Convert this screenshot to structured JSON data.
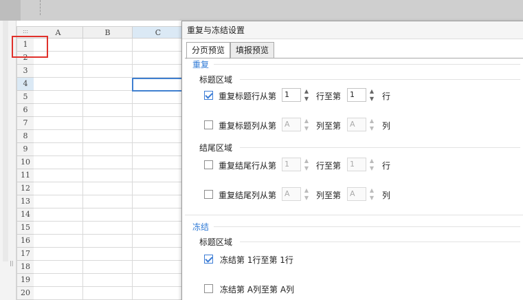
{
  "sheet": {
    "columns": [
      "A",
      "B",
      "C"
    ],
    "rows": [
      "1 (H)",
      "2",
      "3",
      "4",
      "5",
      "6",
      "7",
      "8",
      "9",
      "10",
      "11",
      "12",
      "13",
      "14",
      "15",
      "16",
      "17",
      "18",
      "19",
      "20"
    ],
    "selected_column": "C",
    "selected_row": "4"
  },
  "dialog": {
    "title": "重复与冻结设置",
    "tabs": [
      {
        "label": "分页预览",
        "active": true
      },
      {
        "label": "填报预览",
        "active": false
      }
    ],
    "repeat": {
      "section_label": "重复",
      "title_area_label": "标题区域",
      "row": {
        "checked": true,
        "label": "重复标题行从第",
        "from": "1",
        "mid": "行至第",
        "to": "1",
        "end": "行"
      },
      "col": {
        "checked": false,
        "label": "重复标题列从第",
        "from": "A",
        "mid": "列至第",
        "to": "A",
        "end": "列"
      },
      "footer_area_label": "结尾区域",
      "footer_row": {
        "checked": false,
        "label": "重复结尾行从第",
        "from": "1",
        "mid": "行至第",
        "to": "1",
        "end": "行"
      },
      "footer_col": {
        "checked": false,
        "label": "重复结尾列从第",
        "from": "A",
        "mid": "列至第",
        "to": "A",
        "end": "列"
      }
    },
    "freeze": {
      "section_label": "冻结",
      "title_area_label": "标题区域",
      "row": {
        "checked": true,
        "label": "冻结第 1行至第 1行"
      },
      "col": {
        "checked": false,
        "label": "冻结第 A列至第 A列"
      }
    }
  },
  "colors": {
    "accent": "#2f7ad6",
    "highlight_box": "#e0302a",
    "active_cell_border": "#3f7fd0",
    "selected_header": "#dbe9f5"
  }
}
